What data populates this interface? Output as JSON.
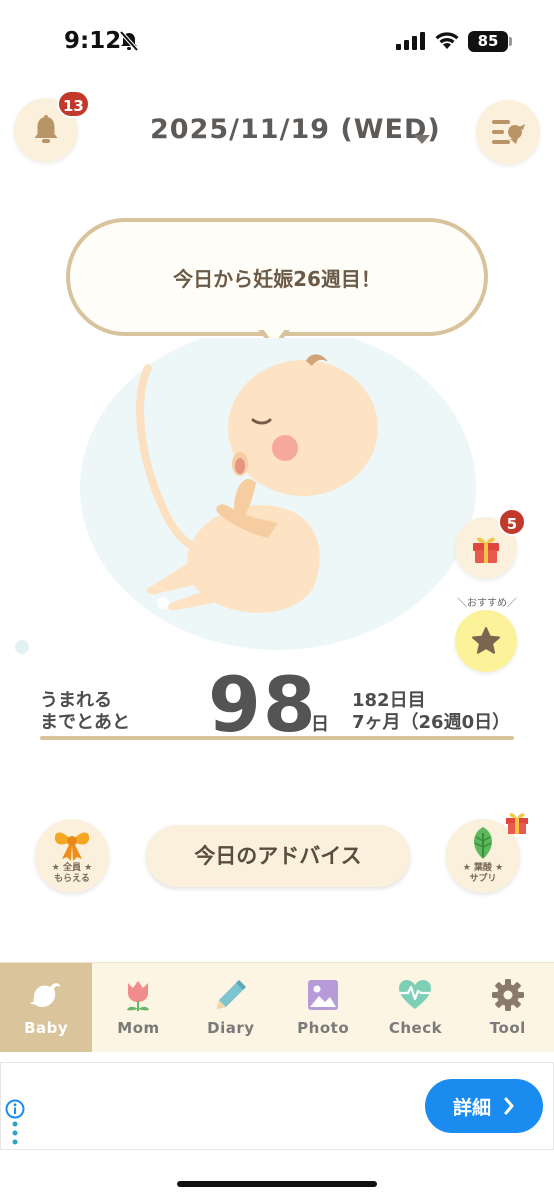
{
  "status_bar": {
    "time": "9:12",
    "battery": "85",
    "icons": [
      "bell-slash-icon",
      "signal-icon",
      "wifi-icon",
      "battery-icon"
    ]
  },
  "header": {
    "notification_count": "13",
    "date": "2025/11/19 (WED)",
    "icons": [
      "bell-icon",
      "menu-icon",
      "chevron-down-icon"
    ]
  },
  "bubble": {
    "message": "今日から妊娠26週目！"
  },
  "side": {
    "gift_count": "5",
    "recommend_label": "＼おすすめ／",
    "icons": [
      "gift-icon",
      "star-icon"
    ]
  },
  "countdown": {
    "label_line1": "うまれる",
    "label_line2": "までとあと",
    "days": "98",
    "unit": "日",
    "elapsed": "182日目",
    "month_week": "7ヶ月（26週0日）"
  },
  "actions": {
    "present_caption_line1": "★ 全員 ★",
    "present_caption_line2": "もらえる",
    "advice_label": "今日のアドバイス",
    "folic_caption_line1": "★ 葉酸 ★",
    "folic_caption_line2": "サプリ",
    "icons": [
      "ribbon-icon",
      "leaf-icon",
      "gift-icon"
    ]
  },
  "tabs": [
    {
      "label": "Baby",
      "icon": "bird-icon",
      "active": true
    },
    {
      "label": "Mom",
      "icon": "tulip-icon",
      "active": false
    },
    {
      "label": "Diary",
      "icon": "pencil-icon",
      "active": false
    },
    {
      "label": "Photo",
      "icon": "photo-icon",
      "active": false
    },
    {
      "label": "Check",
      "icon": "heartbeat-icon",
      "active": false
    },
    {
      "label": "Tool",
      "icon": "gear-icon",
      "active": false
    }
  ],
  "ad": {
    "button_label": "詳細",
    "icons": [
      "info-icon",
      "more-dots-icon",
      "chevron-right-icon"
    ]
  },
  "colors": {
    "accent": "#d9c49b",
    "cream": "#fbf0dc",
    "badge": "#c0392b",
    "ad_button": "#1a8cf0"
  }
}
